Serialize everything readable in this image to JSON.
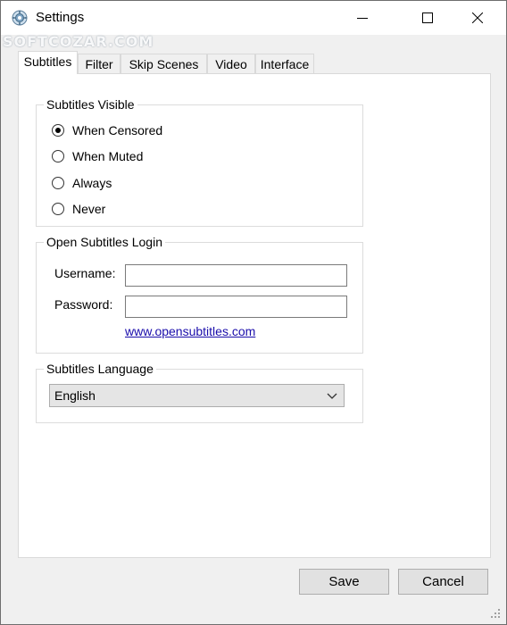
{
  "window": {
    "title": "Settings",
    "watermark": "SOFTCOZAR.COM"
  },
  "tabs": [
    {
      "label": "Subtitles",
      "active": true
    },
    {
      "label": "Filter",
      "active": false
    },
    {
      "label": "Skip Scenes",
      "active": false
    },
    {
      "label": "Video",
      "active": false
    },
    {
      "label": "Interface",
      "active": false
    }
  ],
  "subtitles_visible": {
    "title": "Subtitles Visible",
    "options": [
      {
        "label": "When Censored",
        "checked": true
      },
      {
        "label": "When Muted",
        "checked": false
      },
      {
        "label": "Always",
        "checked": false
      },
      {
        "label": "Never",
        "checked": false
      }
    ]
  },
  "login": {
    "title": "Open Subtitles Login",
    "username_label": "Username:",
    "username_value": "",
    "password_label": "Password:",
    "password_value": "",
    "link_text": "www.opensubtitles.com"
  },
  "language": {
    "title": "Subtitles Language",
    "selected": "English"
  },
  "footer": {
    "save_label": "Save",
    "cancel_label": "Cancel"
  }
}
